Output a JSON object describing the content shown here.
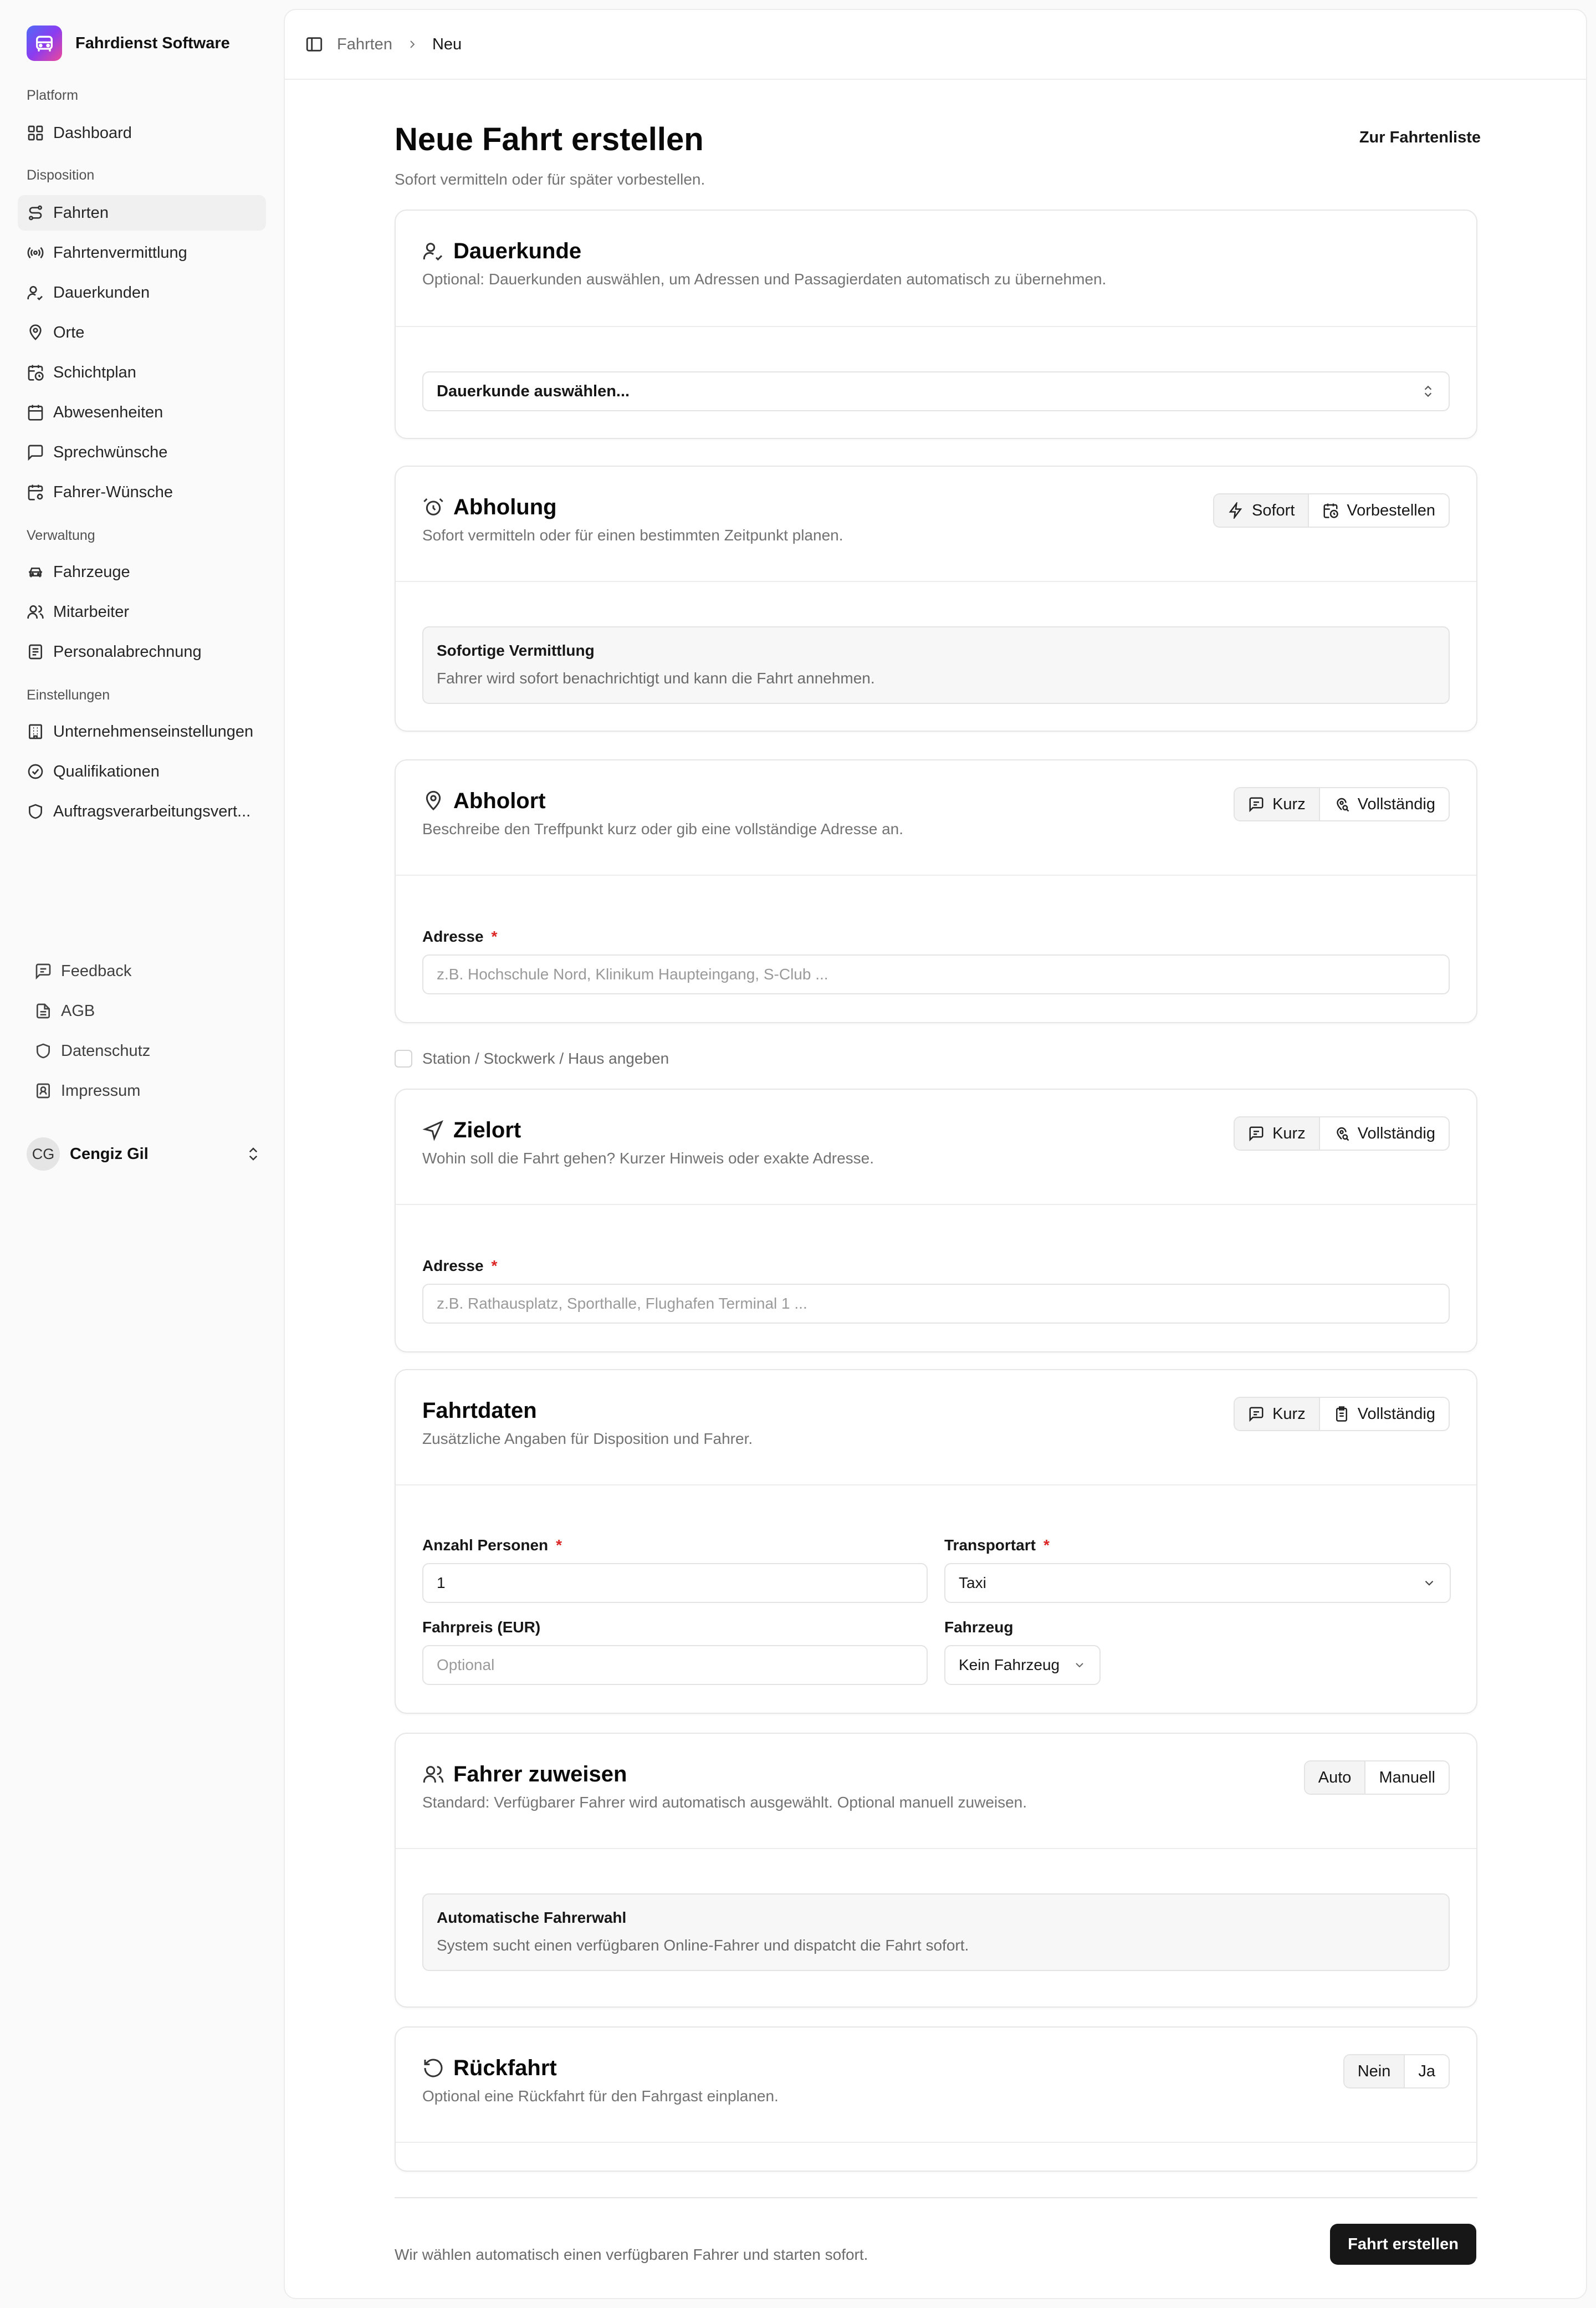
{
  "app": {
    "name": "Fahrdienst Software"
  },
  "sidebar": {
    "groups": [
      {
        "label": "Platform",
        "items": [
          {
            "label": "Dashboard",
            "icon": "dashboard-icon"
          }
        ]
      },
      {
        "label": "Disposition",
        "items": [
          {
            "label": "Fahrten",
            "icon": "route-icon",
            "active": true
          },
          {
            "label": "Fahrtenvermittlung",
            "icon": "radio-icon"
          },
          {
            "label": "Dauerkunden",
            "icon": "user-check-icon"
          },
          {
            "label": "Orte",
            "icon": "map-pin-icon"
          },
          {
            "label": "Schichtplan",
            "icon": "calendar-clock-icon"
          },
          {
            "label": "Abwesenheiten",
            "icon": "calendar-icon"
          },
          {
            "label": "Sprechwünsche",
            "icon": "message-square-icon"
          },
          {
            "label": "Fahrer-Wünsche",
            "icon": "calendar-cog-icon"
          }
        ]
      },
      {
        "label": "Verwaltung",
        "items": [
          {
            "label": "Fahrzeuge",
            "icon": "car-icon"
          },
          {
            "label": "Mitarbeiter",
            "icon": "users-icon"
          },
          {
            "label": "Personalabrechnung",
            "icon": "receipt-icon"
          }
        ]
      },
      {
        "label": "Einstellungen",
        "items": [
          {
            "label": "Unternehmenseinstellungen",
            "icon": "building-icon"
          },
          {
            "label": "Qualifikationen",
            "icon": "check-circle-icon"
          },
          {
            "label": "Auftragsverarbeitungsvert...",
            "icon": "shield-icon"
          }
        ]
      }
    ],
    "footer": [
      {
        "label": "Feedback",
        "icon": "feedback-icon"
      },
      {
        "label": "AGB",
        "icon": "file-text-icon"
      },
      {
        "label": "Datenschutz",
        "icon": "shield-icon"
      },
      {
        "label": "Impressum",
        "icon": "contact-icon"
      }
    ],
    "user": {
      "initials": "CG",
      "name": "Cengiz Gil"
    }
  },
  "breadcrumb": {
    "parent": "Fahrten",
    "current": "Neu"
  },
  "page": {
    "title": "Neue Fahrt erstellen",
    "subtitle": "Sofort vermitteln oder für später vorbestellen.",
    "list_link": "Zur Fahrtenliste"
  },
  "dauerkunde": {
    "title": "Dauerkunde",
    "subtitle": "Optional: Dauerkunden auswählen, um Adressen und Passagierdaten automatisch zu übernehmen.",
    "select_placeholder": "Dauerkunde auswählen..."
  },
  "abholung": {
    "title": "Abholung",
    "subtitle": "Sofort vermitteln oder für einen bestimmten Zeitpunkt planen.",
    "seg_sofort": "Sofort",
    "seg_vorbestellen": "Vorbestellen",
    "info_title": "Sofortige Vermittlung",
    "info_text": "Fahrer wird sofort benachrichtigt und kann die Fahrt annehmen."
  },
  "abholort": {
    "title": "Abholort",
    "subtitle": "Beschreibe den Treffpunkt kurz oder gib eine vollständige Adresse an.",
    "seg_kurz": "Kurz",
    "seg_voll": "Vollständig",
    "address_label": "Adresse",
    "required_mark": "*",
    "address_placeholder": "z.B. Hochschule Nord, Klinikum Haupteingang, S-Club ..."
  },
  "station_checkbox": {
    "label": "Station / Stockwerk / Haus angeben",
    "checked": false
  },
  "zielort": {
    "title": "Zielort",
    "subtitle": "Wohin soll die Fahrt gehen? Kurzer Hinweis oder exakte Adresse.",
    "seg_kurz": "Kurz",
    "seg_voll": "Vollständig",
    "address_label": "Adresse",
    "required_mark": "*",
    "address_placeholder": "z.B. Rathausplatz, Sporthalle, Flughafen Terminal 1 ..."
  },
  "fahrtdaten": {
    "title": "Fahrtdaten",
    "subtitle": "Zusätzliche Angaben für Disposition und Fahrer.",
    "seg_kurz": "Kurz",
    "seg_voll": "Vollständig",
    "persons_label": "Anzahl Personen",
    "persons_value": "1",
    "transport_label": "Transportart",
    "transport_value": "Taxi",
    "price_label": "Fahrpreis (EUR)",
    "price_placeholder": "Optional",
    "vehicle_label": "Fahrzeug",
    "vehicle_value": "Kein Fahrzeug",
    "required_mark": "*"
  },
  "fahrer": {
    "title": "Fahrer zuweisen",
    "subtitle": "Standard: Verfügbarer Fahrer wird automatisch ausgewählt. Optional manuell zuweisen.",
    "seg_auto": "Auto",
    "seg_manuell": "Manuell",
    "info_title": "Automatische Fahrerwahl",
    "info_text": "System sucht einen verfügbaren Online-Fahrer und dispatcht die Fahrt sofort."
  },
  "rueckfahrt": {
    "title": "Rückfahrt",
    "subtitle": "Optional eine Rückfahrt für den Fahrgast einplanen.",
    "seg_nein": "Nein",
    "seg_ja": "Ja"
  },
  "footer": {
    "note": "Wir wählen automatisch einen verfügbaren Fahrer und starten sofort.",
    "submit": "Fahrt erstellen"
  }
}
